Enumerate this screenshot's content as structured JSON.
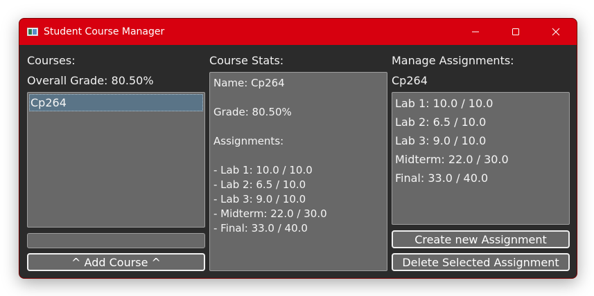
{
  "window": {
    "title": "Student Course Manager",
    "controls": {
      "minimize": "minimize-icon",
      "maximize": "maximize-icon",
      "close": "close-icon"
    },
    "accent_color": "#d7000f"
  },
  "courses_panel": {
    "heading": "Courses:",
    "overall_grade": "Overall Grade: 80.50%",
    "items": [
      {
        "label": "Cp264",
        "selected": true
      }
    ],
    "new_course_input": "",
    "add_button": "^ Add Course ^"
  },
  "stats_panel": {
    "heading": "Course Stats:",
    "lines": [
      "Name: Cp264",
      "",
      "Grade: 80.50%",
      "",
      "Assignments:",
      "",
      "- Lab 1: 10.0 / 10.0",
      "- Lab 2: 6.5 / 10.0",
      "- Lab 3: 9.0 / 10.0",
      "- Midterm: 22.0 / 30.0",
      "- Final: 33.0 / 40.0"
    ]
  },
  "assignments_panel": {
    "heading": "Manage Assignments:",
    "course_name": "Cp264",
    "items": [
      "Lab 1: 10.0 / 10.0",
      "Lab 2: 6.5 / 10.0",
      "Lab 3: 9.0 / 10.0",
      "Midterm: 22.0 / 30.0",
      "Final: 33.0 / 40.0"
    ],
    "create_button": "Create new Assignment",
    "delete_button": "Delete Selected Assignment"
  }
}
